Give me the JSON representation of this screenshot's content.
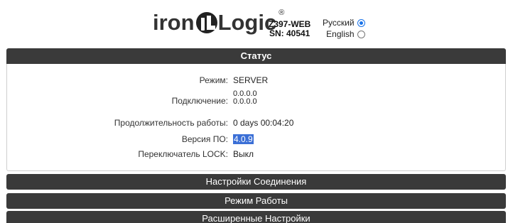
{
  "header": {
    "logo_text_left": "iron",
    "logo_text_right": "Logic",
    "logo_registered": "®",
    "model": "Z397-WEB",
    "serial": "SN: 40541",
    "languages": [
      {
        "label": "Русский",
        "selected": true
      },
      {
        "label": "English",
        "selected": false
      }
    ]
  },
  "sections": {
    "status": "Статус",
    "connection": "Настройки Соединения",
    "mode": "Режим Работы",
    "advanced": "Расширенные Настройки"
  },
  "status": {
    "mode_label": "Режим:",
    "mode_value": "SERVER",
    "connection_label": "Подключение:",
    "connection_value_1": "0.0.0.0",
    "connection_value_2": "0.0.0.0",
    "uptime_label": "Продолжительность работы:",
    "uptime_value": "0 days 00:04:20",
    "firmware_label": "Версия ПО:",
    "firmware_value": "4.0.9",
    "lock_label": "Переключатель LOCK:",
    "lock_value": "Выкл"
  },
  "colors": {
    "section_bar": "#3a3a3a",
    "radio_accent": "#1a73e8",
    "selection_highlight": "#3b6fd6"
  }
}
